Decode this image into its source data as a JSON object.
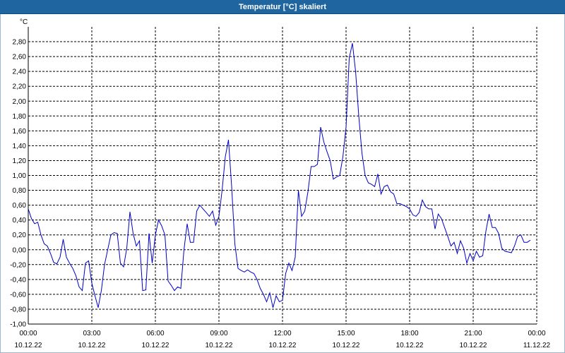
{
  "window": {
    "title": "Temperatur [°C] skaliert"
  },
  "chart_data": {
    "type": "line",
    "title": "Temperatur [°C] skaliert",
    "ylabel": "°C",
    "xlabel": "",
    "ylim": [
      -1.0,
      3.0
    ],
    "xlim_hours": [
      0,
      24
    ],
    "grid": true,
    "line_color": "#0000c8",
    "y_ticks": [
      "-1,00",
      "-0,80",
      "-0,60",
      "-0,40",
      "-0,20",
      "0,00",
      "0,20",
      "0,40",
      "0,60",
      "0,80",
      "1,00",
      "1,20",
      "1,40",
      "1,60",
      "1,80",
      "2,00",
      "2,20",
      "2,40",
      "2,60",
      "2,80"
    ],
    "x_ticks": [
      {
        "time": "00:00",
        "date": "10.12.22"
      },
      {
        "time": "03:00",
        "date": "10.12.22"
      },
      {
        "time": "06:00",
        "date": "10.12.22"
      },
      {
        "time": "09:00",
        "date": "10.12.22"
      },
      {
        "time": "12:00",
        "date": "10.12.22"
      },
      {
        "time": "15:00",
        "date": "10.12.22"
      },
      {
        "time": "18:00",
        "date": "10.12.22"
      },
      {
        "time": "21:00",
        "date": "10.12.22"
      },
      {
        "time": "00:00",
        "date": "11.12.22"
      }
    ],
    "series": [
      {
        "points": [
          [
            0.0,
            0.55
          ],
          [
            0.15,
            0.42
          ],
          [
            0.3,
            0.35
          ],
          [
            0.45,
            0.37
          ],
          [
            0.6,
            0.2
          ],
          [
            0.75,
            0.08
          ],
          [
            0.9,
            0.05
          ],
          [
            1.05,
            -0.05
          ],
          [
            1.2,
            -0.17
          ],
          [
            1.35,
            -0.19
          ],
          [
            1.5,
            -0.1
          ],
          [
            1.65,
            0.14
          ],
          [
            1.8,
            -0.1
          ],
          [
            1.95,
            -0.18
          ],
          [
            2.1,
            -0.25
          ],
          [
            2.25,
            -0.35
          ],
          [
            2.4,
            -0.5
          ],
          [
            2.55,
            -0.55
          ],
          [
            2.7,
            -0.18
          ],
          [
            2.85,
            -0.15
          ],
          [
            3.0,
            -0.45
          ],
          [
            3.15,
            -0.62
          ],
          [
            3.3,
            -0.78
          ],
          [
            3.45,
            -0.55
          ],
          [
            3.6,
            -0.2
          ],
          [
            3.75,
            0.0
          ],
          [
            3.9,
            0.2
          ],
          [
            4.05,
            0.23
          ],
          [
            4.2,
            0.22
          ],
          [
            4.35,
            -0.18
          ],
          [
            4.5,
            -0.23
          ],
          [
            4.65,
            0.02
          ],
          [
            4.8,
            0.51
          ],
          [
            4.95,
            0.22
          ],
          [
            5.1,
            0.05
          ],
          [
            5.25,
            0.12
          ],
          [
            5.4,
            -0.55
          ],
          [
            5.55,
            -0.54
          ],
          [
            5.7,
            0.22
          ],
          [
            5.85,
            -0.18
          ],
          [
            6.0,
            0.2
          ],
          [
            6.15,
            0.4
          ],
          [
            6.3,
            0.32
          ],
          [
            6.45,
            0.2
          ],
          [
            6.6,
            -0.42
          ],
          [
            6.75,
            -0.48
          ],
          [
            6.9,
            -0.55
          ],
          [
            7.05,
            -0.5
          ],
          [
            7.2,
            -0.52
          ],
          [
            7.35,
            0.0
          ],
          [
            7.5,
            0.35
          ],
          [
            7.65,
            0.1
          ],
          [
            7.8,
            0.1
          ],
          [
            7.95,
            0.52
          ],
          [
            8.1,
            0.6
          ],
          [
            8.25,
            0.55
          ],
          [
            8.4,
            0.5
          ],
          [
            8.55,
            0.45
          ],
          [
            8.7,
            0.52
          ],
          [
            8.85,
            0.33
          ],
          [
            9.0,
            0.45
          ],
          [
            9.15,
            0.8
          ],
          [
            9.3,
            1.25
          ],
          [
            9.45,
            1.48
          ],
          [
            9.6,
            0.85
          ],
          [
            9.75,
            0.08
          ],
          [
            9.9,
            -0.25
          ],
          [
            10.05,
            -0.28
          ],
          [
            10.2,
            -0.3
          ],
          [
            10.35,
            -0.27
          ],
          [
            10.5,
            -0.3
          ],
          [
            10.65,
            -0.32
          ],
          [
            10.8,
            -0.4
          ],
          [
            10.95,
            -0.52
          ],
          [
            11.1,
            -0.6
          ],
          [
            11.25,
            -0.7
          ],
          [
            11.4,
            -0.58
          ],
          [
            11.55,
            -0.78
          ],
          [
            11.7,
            -0.62
          ],
          [
            11.85,
            -0.7
          ],
          [
            12.0,
            -0.68
          ],
          [
            12.15,
            -0.32
          ],
          [
            12.3,
            -0.18
          ],
          [
            12.45,
            -0.28
          ],
          [
            12.6,
            -0.1
          ],
          [
            12.75,
            0.8
          ],
          [
            12.9,
            0.45
          ],
          [
            13.05,
            0.52
          ],
          [
            13.2,
            0.78
          ],
          [
            13.35,
            1.12
          ],
          [
            13.5,
            1.12
          ],
          [
            13.65,
            1.15
          ],
          [
            13.8,
            1.65
          ],
          [
            13.95,
            1.45
          ],
          [
            14.1,
            1.32
          ],
          [
            14.25,
            1.2
          ],
          [
            14.4,
            0.95
          ],
          [
            14.55,
            0.98
          ],
          [
            14.7,
            1.0
          ],
          [
            14.85,
            1.25
          ],
          [
            15.0,
            1.65
          ],
          [
            15.15,
            2.58
          ],
          [
            15.3,
            2.78
          ],
          [
            15.45,
            2.4
          ],
          [
            15.6,
            1.8
          ],
          [
            15.75,
            1.3
          ],
          [
            15.9,
            1.0
          ],
          [
            16.05,
            0.9
          ],
          [
            16.2,
            0.88
          ],
          [
            16.35,
            0.85
          ],
          [
            16.5,
            1.02
          ],
          [
            16.65,
            0.75
          ],
          [
            16.8,
            0.85
          ],
          [
            16.95,
            0.87
          ],
          [
            17.1,
            0.78
          ],
          [
            17.25,
            0.75
          ],
          [
            17.4,
            0.62
          ],
          [
            17.55,
            0.62
          ],
          [
            17.7,
            0.6
          ],
          [
            17.85,
            0.58
          ],
          [
            18.0,
            0.55
          ],
          [
            18.15,
            0.47
          ],
          [
            18.3,
            0.45
          ],
          [
            18.45,
            0.5
          ],
          [
            18.6,
            0.67
          ],
          [
            18.75,
            0.58
          ],
          [
            18.9,
            0.55
          ],
          [
            19.05,
            0.55
          ],
          [
            19.2,
            0.28
          ],
          [
            19.35,
            0.48
          ],
          [
            19.5,
            0.42
          ],
          [
            19.65,
            0.3
          ],
          [
            19.8,
            0.18
          ],
          [
            19.95,
            0.05
          ],
          [
            20.1,
            0.1
          ],
          [
            20.25,
            -0.05
          ],
          [
            20.4,
            0.12
          ],
          [
            20.55,
            0.02
          ],
          [
            20.7,
            -0.18
          ],
          [
            20.85,
            -0.05
          ],
          [
            21.0,
            -0.15
          ],
          [
            21.15,
            -0.02
          ],
          [
            21.3,
            -0.1
          ],
          [
            21.45,
            -0.08
          ],
          [
            21.6,
            0.25
          ],
          [
            21.75,
            0.48
          ],
          [
            21.9,
            0.3
          ],
          [
            22.05,
            0.3
          ],
          [
            22.2,
            0.22
          ],
          [
            22.35,
            0.02
          ],
          [
            22.5,
            -0.02
          ],
          [
            22.65,
            -0.03
          ],
          [
            22.8,
            -0.04
          ],
          [
            22.95,
            0.05
          ],
          [
            23.1,
            0.18
          ],
          [
            23.25,
            0.2
          ],
          [
            23.4,
            0.1
          ],
          [
            23.55,
            0.1
          ],
          [
            23.7,
            0.13
          ]
        ]
      }
    ]
  }
}
